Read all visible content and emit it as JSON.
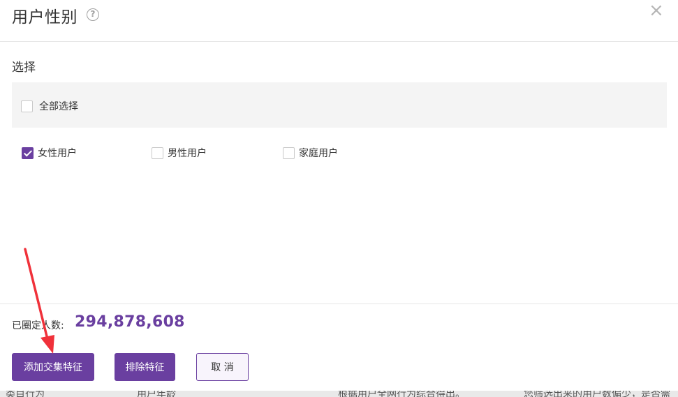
{
  "dialog": {
    "title": "用户性别",
    "help_icon": "question-circle-icon",
    "close_icon": "×",
    "section_label": "选择",
    "select_all_label": "全部选择",
    "options": [
      {
        "label": "女性用户",
        "checked": true
      },
      {
        "label": "男性用户",
        "checked": false
      },
      {
        "label": "家庭用户",
        "checked": false
      }
    ],
    "count_label": "已圈定人数:",
    "count_value": "294,878,608",
    "buttons": {
      "add_intersection": "添加交集特征",
      "exclude": "排除特征",
      "cancel": "取 消"
    }
  },
  "background_strip": {
    "left_text": "类目行为",
    "middle_text": "用户年龄",
    "desc_text": "根据用户全网行为综合得出。",
    "warning_text": "您筛选出来的用户数偏少，是否需"
  },
  "colors": {
    "accent": "#6a3fa0",
    "annotation_arrow": "#f0313a"
  }
}
